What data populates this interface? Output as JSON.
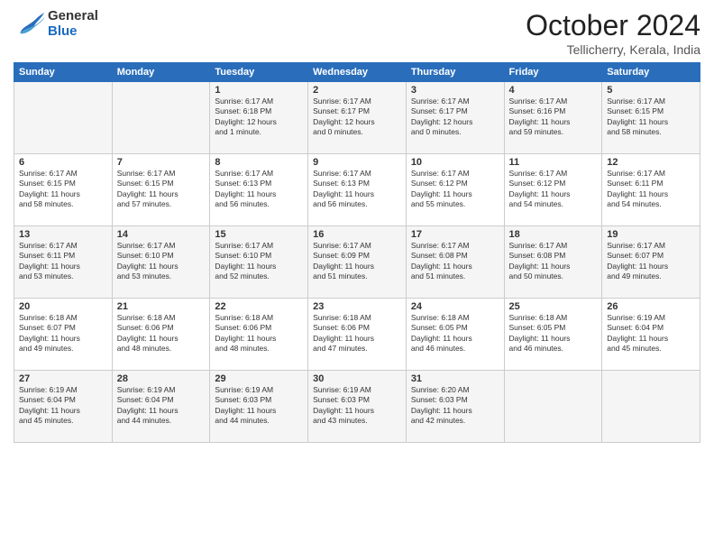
{
  "logo": {
    "general": "General",
    "blue": "Blue"
  },
  "header": {
    "month_title": "October 2024",
    "location": "Tellicherry, Kerala, India"
  },
  "days_of_week": [
    "Sunday",
    "Monday",
    "Tuesday",
    "Wednesday",
    "Thursday",
    "Friday",
    "Saturday"
  ],
  "weeks": [
    [
      {
        "day": "",
        "info": ""
      },
      {
        "day": "",
        "info": ""
      },
      {
        "day": "1",
        "info": "Sunrise: 6:17 AM\nSunset: 6:18 PM\nDaylight: 12 hours\nand 1 minute."
      },
      {
        "day": "2",
        "info": "Sunrise: 6:17 AM\nSunset: 6:17 PM\nDaylight: 12 hours\nand 0 minutes."
      },
      {
        "day": "3",
        "info": "Sunrise: 6:17 AM\nSunset: 6:17 PM\nDaylight: 12 hours\nand 0 minutes."
      },
      {
        "day": "4",
        "info": "Sunrise: 6:17 AM\nSunset: 6:16 PM\nDaylight: 11 hours\nand 59 minutes."
      },
      {
        "day": "5",
        "info": "Sunrise: 6:17 AM\nSunset: 6:15 PM\nDaylight: 11 hours\nand 58 minutes."
      }
    ],
    [
      {
        "day": "6",
        "info": "Sunrise: 6:17 AM\nSunset: 6:15 PM\nDaylight: 11 hours\nand 58 minutes."
      },
      {
        "day": "7",
        "info": "Sunrise: 6:17 AM\nSunset: 6:15 PM\nDaylight: 11 hours\nand 57 minutes."
      },
      {
        "day": "8",
        "info": "Sunrise: 6:17 AM\nSunset: 6:13 PM\nDaylight: 11 hours\nand 56 minutes."
      },
      {
        "day": "9",
        "info": "Sunrise: 6:17 AM\nSunset: 6:13 PM\nDaylight: 11 hours\nand 56 minutes."
      },
      {
        "day": "10",
        "info": "Sunrise: 6:17 AM\nSunset: 6:12 PM\nDaylight: 11 hours\nand 55 minutes."
      },
      {
        "day": "11",
        "info": "Sunrise: 6:17 AM\nSunset: 6:12 PM\nDaylight: 11 hours\nand 54 minutes."
      },
      {
        "day": "12",
        "info": "Sunrise: 6:17 AM\nSunset: 6:11 PM\nDaylight: 11 hours\nand 54 minutes."
      }
    ],
    [
      {
        "day": "13",
        "info": "Sunrise: 6:17 AM\nSunset: 6:11 PM\nDaylight: 11 hours\nand 53 minutes."
      },
      {
        "day": "14",
        "info": "Sunrise: 6:17 AM\nSunset: 6:10 PM\nDaylight: 11 hours\nand 53 minutes."
      },
      {
        "day": "15",
        "info": "Sunrise: 6:17 AM\nSunset: 6:10 PM\nDaylight: 11 hours\nand 52 minutes."
      },
      {
        "day": "16",
        "info": "Sunrise: 6:17 AM\nSunset: 6:09 PM\nDaylight: 11 hours\nand 51 minutes."
      },
      {
        "day": "17",
        "info": "Sunrise: 6:17 AM\nSunset: 6:08 PM\nDaylight: 11 hours\nand 51 minutes."
      },
      {
        "day": "18",
        "info": "Sunrise: 6:17 AM\nSunset: 6:08 PM\nDaylight: 11 hours\nand 50 minutes."
      },
      {
        "day": "19",
        "info": "Sunrise: 6:17 AM\nSunset: 6:07 PM\nDaylight: 11 hours\nand 49 minutes."
      }
    ],
    [
      {
        "day": "20",
        "info": "Sunrise: 6:18 AM\nSunset: 6:07 PM\nDaylight: 11 hours\nand 49 minutes."
      },
      {
        "day": "21",
        "info": "Sunrise: 6:18 AM\nSunset: 6:06 PM\nDaylight: 11 hours\nand 48 minutes."
      },
      {
        "day": "22",
        "info": "Sunrise: 6:18 AM\nSunset: 6:06 PM\nDaylight: 11 hours\nand 48 minutes."
      },
      {
        "day": "23",
        "info": "Sunrise: 6:18 AM\nSunset: 6:06 PM\nDaylight: 11 hours\nand 47 minutes."
      },
      {
        "day": "24",
        "info": "Sunrise: 6:18 AM\nSunset: 6:05 PM\nDaylight: 11 hours\nand 46 minutes."
      },
      {
        "day": "25",
        "info": "Sunrise: 6:18 AM\nSunset: 6:05 PM\nDaylight: 11 hours\nand 46 minutes."
      },
      {
        "day": "26",
        "info": "Sunrise: 6:19 AM\nSunset: 6:04 PM\nDaylight: 11 hours\nand 45 minutes."
      }
    ],
    [
      {
        "day": "27",
        "info": "Sunrise: 6:19 AM\nSunset: 6:04 PM\nDaylight: 11 hours\nand 45 minutes."
      },
      {
        "day": "28",
        "info": "Sunrise: 6:19 AM\nSunset: 6:04 PM\nDaylight: 11 hours\nand 44 minutes."
      },
      {
        "day": "29",
        "info": "Sunrise: 6:19 AM\nSunset: 6:03 PM\nDaylight: 11 hours\nand 44 minutes."
      },
      {
        "day": "30",
        "info": "Sunrise: 6:19 AM\nSunset: 6:03 PM\nDaylight: 11 hours\nand 43 minutes."
      },
      {
        "day": "31",
        "info": "Sunrise: 6:20 AM\nSunset: 6:03 PM\nDaylight: 11 hours\nand 42 minutes."
      },
      {
        "day": "",
        "info": ""
      },
      {
        "day": "",
        "info": ""
      }
    ]
  ]
}
